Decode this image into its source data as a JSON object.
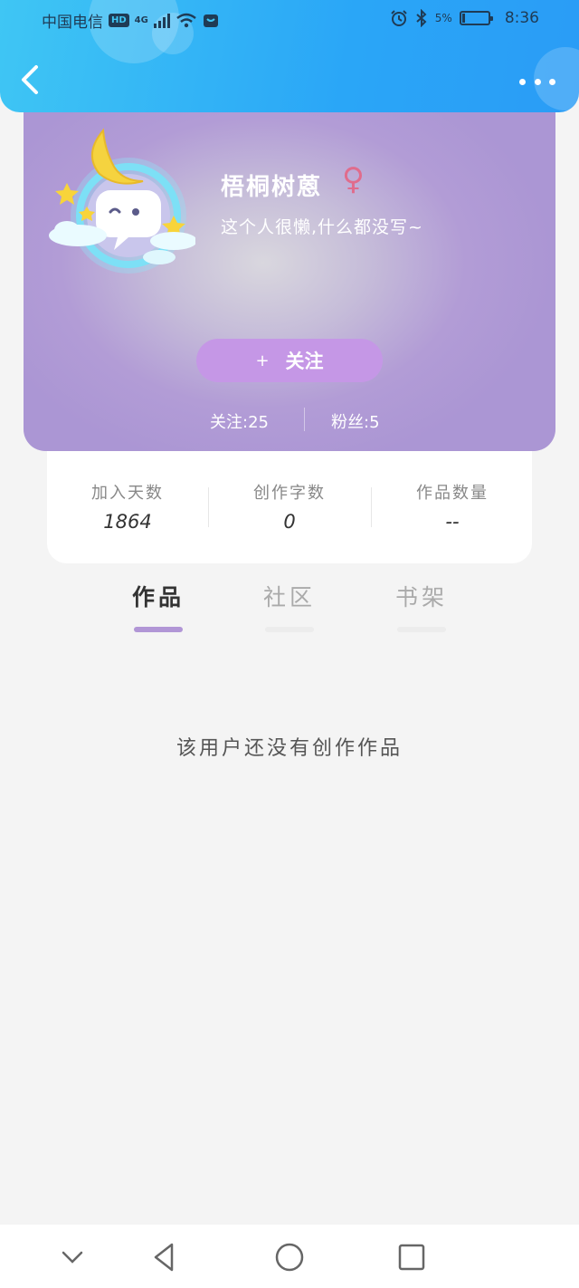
{
  "status_bar": {
    "carrier": "中国电信",
    "hd": "HD",
    "network": "4G",
    "battery": "5%",
    "time": "8:36"
  },
  "header": {
    "back_icon": "chevron-left-icon",
    "more_icon": "more-dots-icon"
  },
  "profile": {
    "username": "梧桐树蒽",
    "gender_symbol": "♀",
    "bio": "这个人很懒,什么都没写~",
    "follow_plus": "+",
    "follow_label": "关注",
    "following": "关注:25",
    "fans": "粉丝:5"
  },
  "stats": [
    {
      "label": "加入天数",
      "value": "1864"
    },
    {
      "label": "创作字数",
      "value": "0"
    },
    {
      "label": "作品数量",
      "value": "--"
    }
  ],
  "tabs": [
    {
      "label": "作品",
      "active": true
    },
    {
      "label": "社区",
      "active": false
    },
    {
      "label": "书架",
      "active": false
    }
  ],
  "empty_message": "该用户还没有创作作品",
  "colors": {
    "header_gradient_start": "#3fc6f4",
    "header_gradient_end": "#2a9cf6",
    "card_purple": "#ab96d4",
    "follow_button": "#c597e6",
    "tab_indicator": "#b196d6",
    "gender": "#e06c8c"
  },
  "nav_bar": [
    "chevron-down-icon",
    "back-triangle-icon",
    "home-circle-icon",
    "recents-square-icon"
  ]
}
